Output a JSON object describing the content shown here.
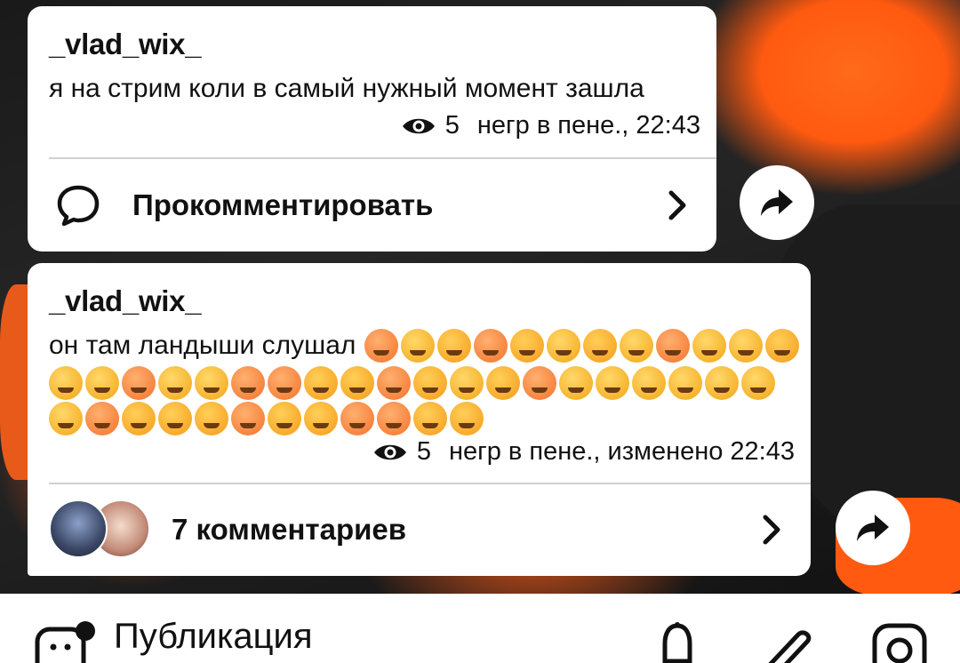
{
  "posts": [
    {
      "author": "_vlad_wix_",
      "text": "я на стрим коли в самый нужный момент зашла",
      "views": "5",
      "meta": "негр в пене., 22:43",
      "action_label": "Прокомментировать"
    },
    {
      "author": "_vlad_wix_",
      "text": "он там ландыши слушал",
      "views": "5",
      "meta": "негр в пене., изменено 22:43",
      "action_label": "7 комментариев"
    }
  ],
  "bottom_bar": {
    "label": "Публикация"
  },
  "colors": {
    "card": "#ffffff",
    "text": "#111111",
    "divider": "#d0d0d0",
    "accent_bg": "#ff5a10"
  },
  "icons": [
    "eye-icon",
    "comment-bubble-icon",
    "chevron-right-icon",
    "share-arrow-icon",
    "sticker-icon",
    "bell-icon",
    "paperclip-icon",
    "camera-icon"
  ]
}
